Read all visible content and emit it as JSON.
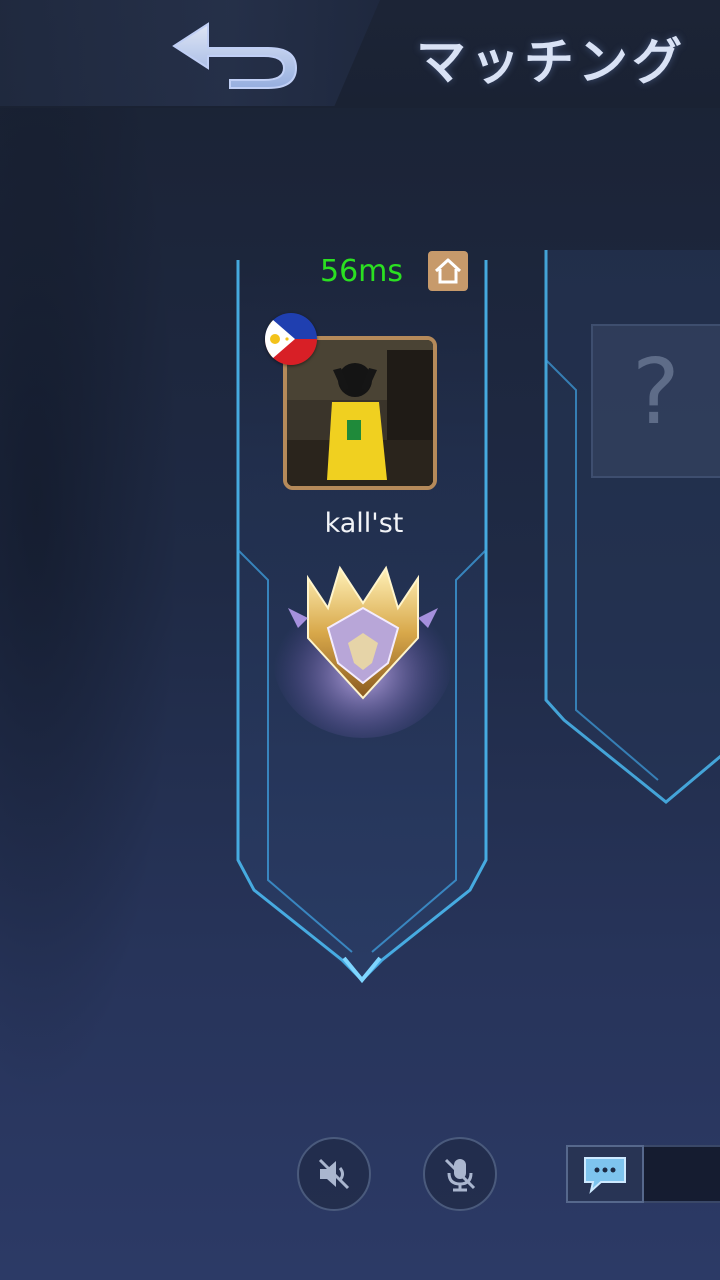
{
  "header": {
    "title": "マッチング",
    "back_icon": "back-arrow-icon"
  },
  "player": {
    "ping": "56ms",
    "name": "kall'st",
    "country_flag": "philippines-flag-icon",
    "home_icon": "home-icon",
    "rank_icon": "mythic-rank-badge-icon"
  },
  "slot_2": {
    "placeholder_icon": "question-mark-icon",
    "placeholder_text": "?"
  },
  "controls": {
    "speaker_icon": "speaker-muted-icon",
    "mic_icon": "mic-muted-icon",
    "chat_icon": "chat-bubble-icon"
  },
  "colors": {
    "ping_green": "#2be021",
    "accent_blue": "#4ab8f0",
    "frame_gold": "#b58a5a",
    "home_tan": "#c79a6b"
  }
}
